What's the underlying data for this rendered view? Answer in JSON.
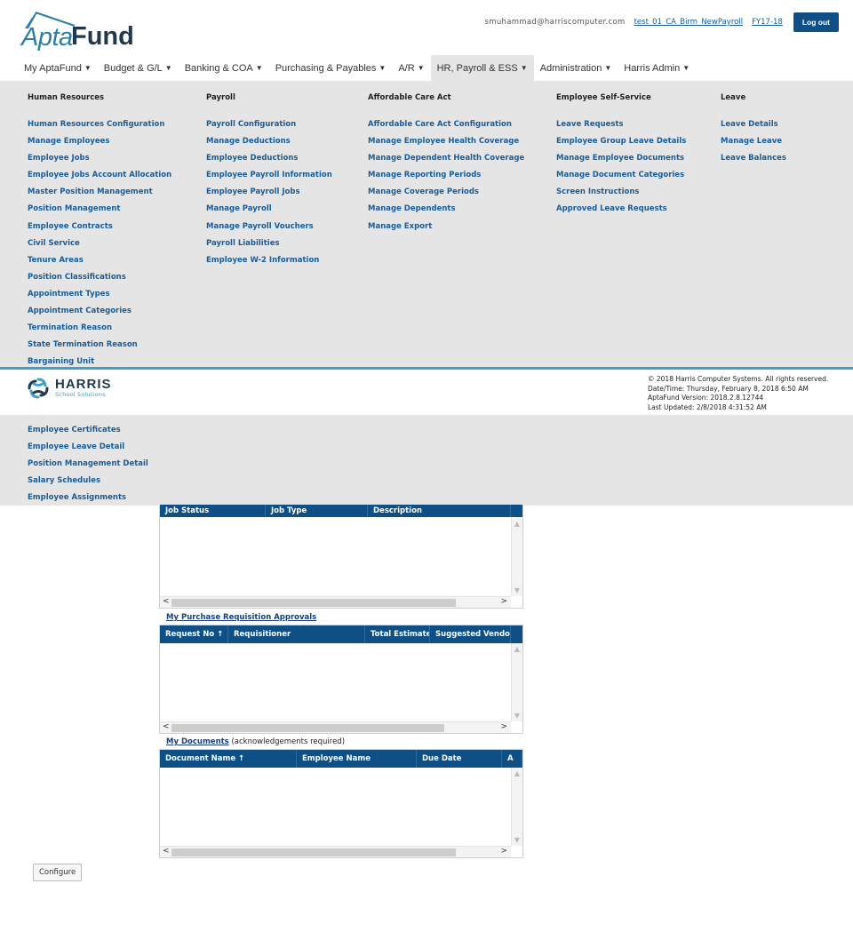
{
  "header": {
    "logo_part1": "Apta",
    "logo_part2": "Fund",
    "email": "smuhammad@harriscomputer.com",
    "database_link": "test_01_CA_Birm_NewPayroll",
    "fiscal_year_link": "FY17-18",
    "logout_label": "Log out"
  },
  "nav": [
    {
      "label": "My AptaFund"
    },
    {
      "label": "Budget & G/L"
    },
    {
      "label": "Banking & COA"
    },
    {
      "label": "Purchasing & Payables"
    },
    {
      "label": "A/R"
    },
    {
      "label": "HR, Payroll & ESS",
      "active": true
    },
    {
      "label": "Administration"
    },
    {
      "label": "Harris Admin"
    }
  ],
  "megamenu": {
    "hr": {
      "heading": "Human Resources",
      "items": [
        "Human Resources Configuration",
        "Manage Employees",
        "Employee Jobs",
        "Employee Jobs Account Allocation",
        "Master Position Management",
        "Position Management",
        "Employee Contracts",
        "Civil Service",
        "Tenure Areas",
        "Position Classifications",
        "Appointment Types",
        "Appointment Categories",
        "Termination Reason",
        "State Termination Reason",
        "Bargaining Unit"
      ],
      "items_lower": [
        "Employee Certificates",
        "Employee Leave Detail",
        "Position Management Detail",
        "Salary Schedules",
        "Employee Assignments"
      ]
    },
    "payroll": {
      "heading": "Payroll",
      "items": [
        "Payroll Configuration",
        "Manage Deductions",
        "Employee Deductions",
        "Employee Payroll Information",
        "Employee Payroll Jobs",
        "Manage Payroll",
        "Manage Payroll Vouchers",
        "Payroll Liabilities",
        "Employee W-2 Information"
      ]
    },
    "aca": {
      "heading": "Affordable Care Act",
      "items": [
        "Affordable Care Act Configuration",
        "Manage Employee Health Coverage",
        "Manage Dependent Health Coverage",
        "Manage Reporting Periods",
        "Manage Coverage Periods",
        "Manage Dependents",
        "Manage Export"
      ]
    },
    "ess": {
      "heading": "Employee Self-Service",
      "items": [
        "Leave Requests",
        "Employee Group Leave Details",
        "Manage Employee Documents",
        "Manage Document Categories",
        "Screen Instructions",
        "Approved Leave Requests"
      ]
    },
    "leave": {
      "heading": "Leave",
      "items": [
        "Leave Details",
        "Manage Leave",
        "Leave Balances"
      ]
    }
  },
  "footer": {
    "brand": "HARRIS",
    "brand_sub": "School Solutions",
    "copyright": "© 2018 Harris Computer Systems. All rights reserved.",
    "datetime": "Date/Time: Thursday, February 8, 2018 6:50 AM",
    "version": "AptaFund Version: 2018.2.8.12744",
    "updated": "Last Updated: 2/8/2018 4:31:52 AM"
  },
  "jobs_panel": {
    "columns": [
      "Job Status",
      "Job Type",
      "Description"
    ]
  },
  "requisitions": {
    "link": "My Purchase Requisition Approvals",
    "columns": [
      "Request No ↑",
      "Requisitioner",
      "Total Estimate",
      "Suggested Vendor"
    ]
  },
  "documents": {
    "link": "My Documents",
    "note": "(acknowledgements required)",
    "columns": [
      "Document Name ↑",
      "Employee Name",
      "Due Date",
      "A"
    ]
  },
  "configure_label": "Configure"
}
